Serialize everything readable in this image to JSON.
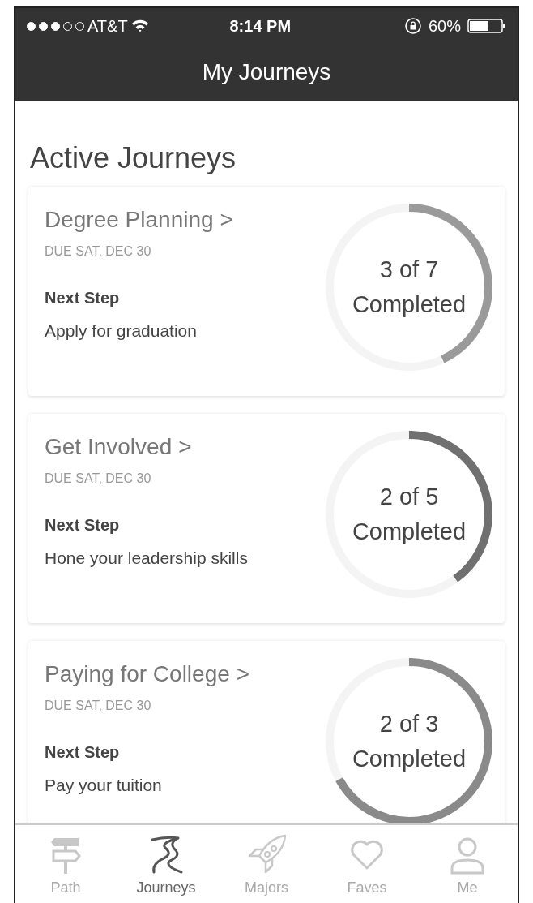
{
  "status_bar": {
    "carrier": "AT&T",
    "time": "8:14 PM",
    "battery_text": "60%"
  },
  "title": "My Journeys",
  "section_title": "Active Journeys",
  "journeys": [
    {
      "title": "Degree Planning",
      "chevron": ">",
      "due": "DUE SAT, DEC 30",
      "next_label": "Next Step",
      "next_step": "Apply for graduation",
      "progress_count": "3 of 7",
      "progress_label": "Completed",
      "level": 0.43,
      "color": "#9a9a9a"
    },
    {
      "title": "Get Involved",
      "chevron": ">",
      "due": "DUE SAT, DEC 30",
      "next_label": "Next Step",
      "next_step": "Hone your leadership skills",
      "progress_count": "2 of 5",
      "progress_label": "Completed",
      "level": 0.4,
      "color": "#707070"
    },
    {
      "title": "Paying for College",
      "chevron": ">",
      "due": "DUE SAT, DEC 30",
      "next_label": "Next Step",
      "next_step": "Pay your tuition",
      "progress_count": "2 of 3",
      "progress_label": "Completed",
      "level": 0.67,
      "color": "#8a8a8a"
    }
  ],
  "tabs": [
    {
      "label": "Path",
      "kind": "signpost",
      "selected": false
    },
    {
      "label": "Journeys",
      "kind": "road",
      "selected": true
    },
    {
      "label": "Majors",
      "kind": "rocket",
      "selected": false
    },
    {
      "label": "Faves",
      "kind": "heart",
      "selected": false
    },
    {
      "label": "Me",
      "kind": "person",
      "selected": false
    }
  ]
}
